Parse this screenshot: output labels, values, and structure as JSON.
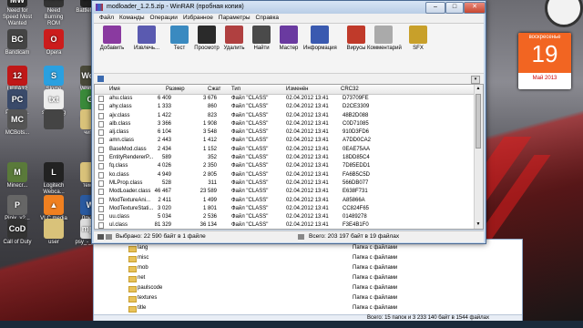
{
  "desktop": {
    "icons": [
      {
        "label": "Need for Speed Most Wanted",
        "short": "NfS MW",
        "color": "#2a2a2a"
      },
      {
        "label": "Need Burning ROM",
        "short": "ROM",
        "color": "#333"
      },
      {
        "label": "Battlefield 3",
        "short": "BF3",
        "color": "#222"
      },
      {
        "label": "Bandicam",
        "short": "BC",
        "color": "#444"
      },
      {
        "label": "Opera",
        "short": "O",
        "color": "#cc1c1c"
      },
      {
        "label": "UEFA12",
        "short": "12",
        "color": "#c01818"
      },
      {
        "label": "Skype",
        "short": "S",
        "color": "#2aa0e0"
      },
      {
        "label": "World of Tanks",
        "short": "WoT",
        "color": "#4a4a3a"
      },
      {
        "label": "PlayCla...",
        "short": "PC",
        "color": "#3a4a6a"
      },
      {
        "label": "server.log",
        "short": "txt",
        "color": "#ededed"
      },
      {
        "label": "Google Chrome",
        "short": "G",
        "color": "#3a8a3a"
      },
      {
        "label": "MCBots...",
        "short": "MC",
        "color": "#555"
      },
      {
        "label": "",
        "short": "",
        "color": "#444"
      },
      {
        "label": "читы",
        "short": "",
        "color": "#d9c27a"
      },
      {
        "label": "Minecr...",
        "short": "M",
        "color": "#5a7a3a"
      },
      {
        "label": "Logitech Webca...",
        "short": "L",
        "color": "#222"
      },
      {
        "label": "темка",
        "short": "",
        "color": "#d9c27a"
      },
      {
        "label": "Pipix_v2...",
        "short": "P",
        "color": "#666"
      },
      {
        "label": "VLC media player",
        "short": "▲",
        "color": "#f08020"
      },
      {
        "label": "Друзья онлайн",
        "short": "W",
        "color": "#2a5aa0"
      },
      {
        "label": "Call of Duty",
        "short": "CoD",
        "color": "#333"
      },
      {
        "label": "user",
        "short": "",
        "color": "#d9c27a"
      },
      {
        "label": "psy_-_gan...",
        "short": "mp4",
        "color": "#ddd"
      },
      {
        "label": "Call of Duty United Of...",
        "short": "CoD",
        "color": "#333"
      }
    ]
  },
  "gadget": {
    "day_of_week": "воскресенье",
    "day": "19",
    "month_year": "Май 2013"
  },
  "winrar": {
    "title": "modloader_1.2.5.zip - WinRAR (пробная копия)",
    "window_buttons": {
      "minimize": "–",
      "maximize": "□",
      "close": "✕"
    },
    "menu": [
      "Файл",
      "Команды",
      "Операции",
      "Избранное",
      "Параметры",
      "Справка"
    ],
    "toolbar": [
      {
        "label": "Добавить",
        "icon": "add-books-icon",
        "color": "#8a3aa0"
      },
      {
        "label": "Извлечь...",
        "icon": "extract-books-icon",
        "color": "#5a5ab0"
      },
      {
        "label": "Тест",
        "icon": "test-icon",
        "color": "#3a8ac0"
      },
      {
        "label": "Просмотр",
        "icon": "view-glasses-icon",
        "color": "#2a2a2a"
      },
      {
        "label": "Удалить",
        "icon": "delete-icon",
        "color": "#b04040"
      },
      {
        "label": "Найти",
        "icon": "find-binoculars-icon",
        "color": "#4a4a4a"
      },
      {
        "label": "Мастер",
        "icon": "wizard-icon",
        "color": "#6a3aa0"
      },
      {
        "label": "Информация",
        "icon": "info-icon",
        "color": "#3a5ab0"
      },
      {
        "label": "Вирусы",
        "icon": "virus-scan-icon",
        "color": "#c03a2a"
      },
      {
        "label": "Комментарий",
        "icon": "comment-icon",
        "color": "#aaaaaa"
      },
      {
        "label": "SFX",
        "icon": "sfx-icon",
        "color": "#c8a02a"
      }
    ],
    "columns": [
      "Имя",
      "Размер",
      "Сжат",
      "Тип",
      "Изменён",
      "CRC32"
    ],
    "files": [
      {
        "name": "ahu.class",
        "size": "6 409",
        "packed": "3 676",
        "type": "Файл \"CLASS\"",
        "modified": "02.04.2012 13:41",
        "crc": "D73709FE"
      },
      {
        "name": "ahy.class",
        "size": "1 333",
        "packed": "860",
        "type": "Файл \"CLASS\"",
        "modified": "02.04.2012 13:41",
        "crc": "D2CE3309"
      },
      {
        "name": "ajv.class",
        "size": "1 422",
        "packed": "823",
        "type": "Файл \"CLASS\"",
        "modified": "02.04.2012 13:41",
        "crc": "48B2D088"
      },
      {
        "name": "alb.class",
        "size": "3 366",
        "packed": "1 908",
        "type": "Файл \"CLASS\"",
        "modified": "02.04.2012 13:41",
        "crc": "C0D71085"
      },
      {
        "name": "alj.class",
        "size": "6 104",
        "packed": "3 548",
        "type": "Файл \"CLASS\"",
        "modified": "02.04.2012 13:41",
        "crc": "910D3FD6"
      },
      {
        "name": "amn.class",
        "size": "2 443",
        "packed": "1 412",
        "type": "Файл \"CLASS\"",
        "modified": "02.04.2012 13:41",
        "crc": "A7DD0CA2"
      },
      {
        "name": "BaseMod.class",
        "size": "2 434",
        "packed": "1 152",
        "type": "Файл \"CLASS\"",
        "modified": "02.04.2012 13:41",
        "crc": "0EAE75AA"
      },
      {
        "name": "EntityRendererP...",
        "size": "589",
        "packed": "352",
        "type": "Файл \"CLASS\"",
        "modified": "02.04.2012 13:41",
        "crc": "18DD85C4"
      },
      {
        "name": "fq.class",
        "size": "4 026",
        "packed": "2 350",
        "type": "Файл \"CLASS\"",
        "modified": "02.04.2012 13:41",
        "crc": "7D85EDD1"
      },
      {
        "name": "ko.class",
        "size": "4 949",
        "packed": "2 805",
        "type": "Файл \"CLASS\"",
        "modified": "02.04.2012 13:41",
        "crc": "FA6B5C5D"
      },
      {
        "name": "MLProp.class",
        "size": "528",
        "packed": "311",
        "type": "Файл \"CLASS\"",
        "modified": "02.04.2012 13:41",
        "crc": "566DB077"
      },
      {
        "name": "ModLoader.class",
        "size": "46 467",
        "packed": "23 589",
        "type": "Файл \"CLASS\"",
        "modified": "02.04.2012 13:41",
        "crc": "E638F731"
      },
      {
        "name": "ModTextureAni...",
        "size": "2 411",
        "packed": "1 499",
        "type": "Файл \"CLASS\"",
        "modified": "02.04.2012 13:41",
        "crc": "A85866A"
      },
      {
        "name": "ModTextureStati...",
        "size": "3 020",
        "packed": "1 801",
        "type": "Файл \"CLASS\"",
        "modified": "02.04.2012 13:41",
        "crc": "CC824F65"
      },
      {
        "name": "uu.class",
        "size": "5 034",
        "packed": "2 536",
        "type": "Файл \"CLASS\"",
        "modified": "02.04.2012 13:41",
        "crc": "01489278"
      },
      {
        "name": "ul.class",
        "size": "81 329",
        "packed": "36 134",
        "type": "Файл \"CLASS\"",
        "modified": "02.04.2012 13:41",
        "crc": "F3E4B1F0"
      }
    ],
    "status_left": "Выбрано: 22 590 байт в 1 файле",
    "status_right": "Всего: 203 197 байт в 19 файлах"
  },
  "explorer": {
    "folders": [
      {
        "name": "lang",
        "type": "Папка с файлами"
      },
      {
        "name": "misc",
        "type": "Папка с файлами"
      },
      {
        "name": "mob",
        "type": "Папка с файлами"
      },
      {
        "name": "net",
        "type": "Папка с файлами"
      },
      {
        "name": "paulscode",
        "type": "Папка с файлами"
      },
      {
        "name": "textures",
        "type": "Папка с файлами"
      },
      {
        "name": "title",
        "type": "Папка с файлами"
      }
    ],
    "status": "Всего: 15 папок и 3 233 140 байт в 1544 файлах"
  }
}
